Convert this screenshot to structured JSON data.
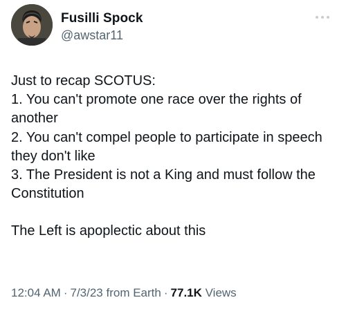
{
  "author": {
    "display_name": "Fusilli Spock",
    "handle": "@awstar11",
    "avatar_icon": "profile-avatar"
  },
  "more_icon": "ellipsis-icon",
  "tweet": {
    "lines": [
      "Just to recap SCOTUS:",
      "1. You can't promote one race over the rights of another",
      "2. You can't compel people to participate in speech they don't like",
      "3. The President is not a King and must follow the Constitution"
    ],
    "closing": "The Left is apoplectic about this"
  },
  "meta": {
    "time": "12:04 AM",
    "date": "7/3/23",
    "source": "from Earth",
    "separator": "·",
    "views_count": "77.1K",
    "views_label": "Views"
  },
  "colors": {
    "text": "#0f1419",
    "secondary": "#536471",
    "background": "#ffffff"
  }
}
